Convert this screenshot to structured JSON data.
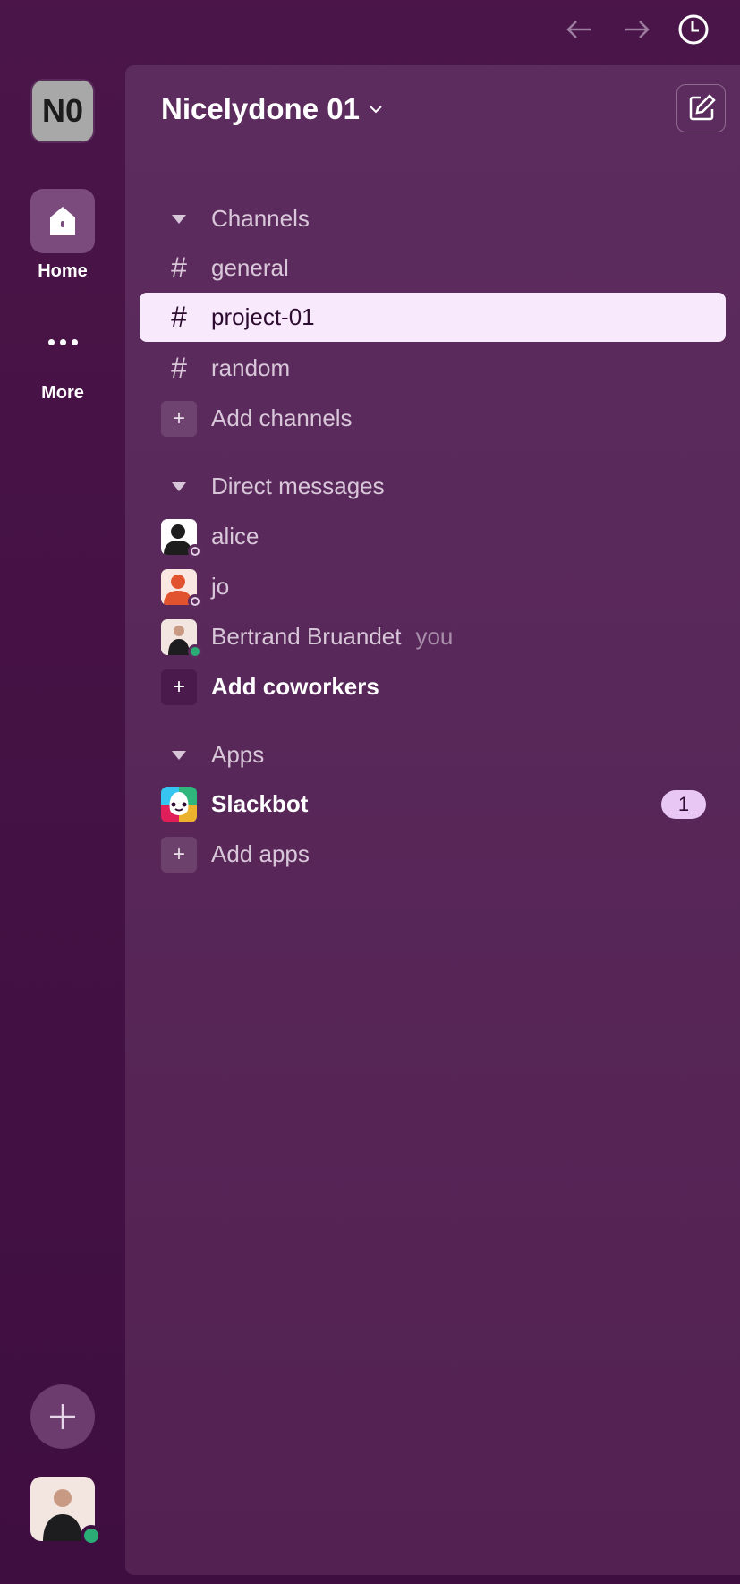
{
  "nav": {
    "back": "back-arrow-icon",
    "forward": "forward-arrow-icon",
    "history": "clock-icon"
  },
  "rail": {
    "workspace_initials": "N0",
    "home_label": "Home",
    "more_label": "More"
  },
  "workspace": {
    "name": "Nicelydone 01"
  },
  "channels": {
    "header": "Channels",
    "items": [
      {
        "name": "general"
      },
      {
        "name": "project-01",
        "selected": true
      },
      {
        "name": "random"
      }
    ],
    "add_label": "Add channels"
  },
  "dms": {
    "header": "Direct messages",
    "items": [
      {
        "name": "alice"
      },
      {
        "name": "jo"
      },
      {
        "name": "Bertrand Bruandet",
        "suffix": "you"
      }
    ],
    "add_label": "Add coworkers"
  },
  "apps": {
    "header": "Apps",
    "items": [
      {
        "name": "Slackbot",
        "badge": "1"
      }
    ],
    "add_label": "Add apps"
  },
  "colors": {
    "bg": "#4a1548",
    "panel": "#5d2c5f",
    "selected": "#f8eafc",
    "badge": "#e8c7f5",
    "online": "#2bac76"
  }
}
